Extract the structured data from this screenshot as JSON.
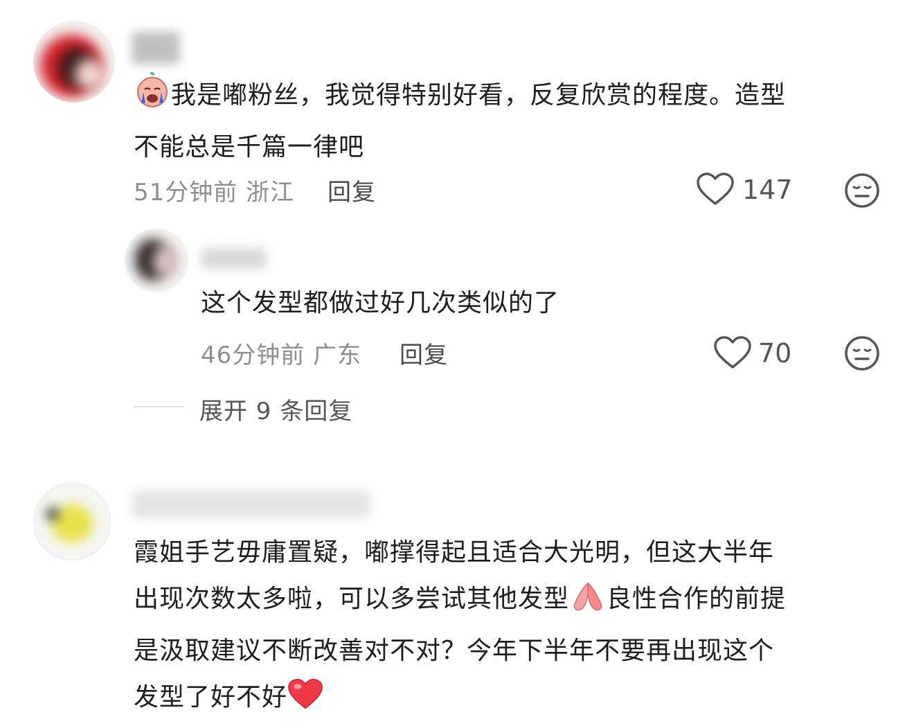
{
  "comments": [
    {
      "text_line1": "我是嘟粉丝，我觉得特别好看，反复欣赏的程度。造型",
      "text_line2": "不能总是千篇一律吧",
      "emoji_prefix": "crying-face-icon",
      "time": "51分钟前",
      "location": "浙江",
      "reply_label": "回复",
      "likes": "147"
    },
    {
      "text": "这个发型都做过好几次类似的了",
      "time": "46分钟前",
      "location": "广东",
      "reply_label": "回复",
      "likes": "70"
    },
    {
      "text_line1": "霞姐手艺毋庸置疑，嘟撑得起且适合大光明，但这大半年",
      "text_line2a": "出现次数太多啦，可以多尝试其他发型",
      "text_line2b": "良性合作的前提",
      "text_line3": "是汲取建议不断改善对不对？今年下半年不要再出现这个",
      "text_line4": "发型了好不好"
    }
  ],
  "expand_replies": "展开 9 条回复",
  "colors": {
    "text": "#1d1d1d",
    "meta": "#8e8e8e",
    "heart_red": "#f03a4a"
  }
}
